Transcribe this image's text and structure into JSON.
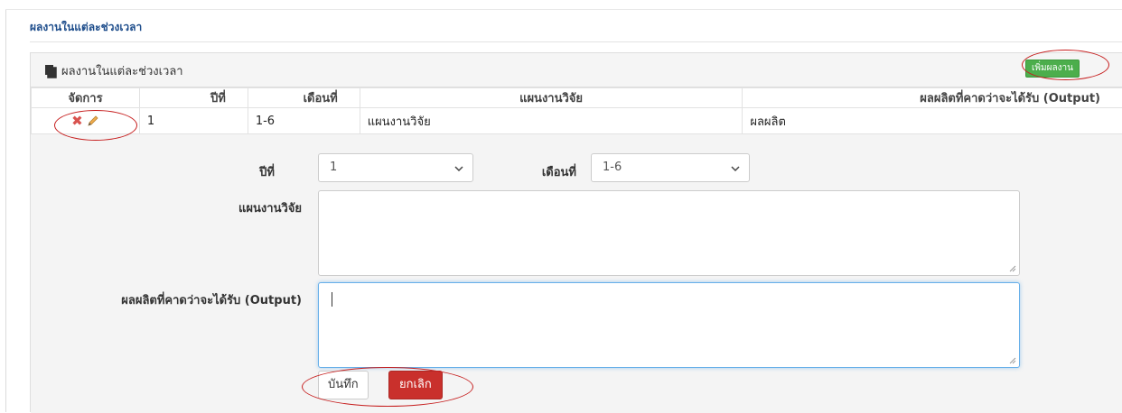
{
  "section_title": "ผลงานในแต่ละช่วงเวลา",
  "panel": {
    "title": "ผลงานในแต่ละช่วงเวลา",
    "add_button": "เพิ่มผลงาน"
  },
  "table": {
    "headers": [
      "จัดการ",
      "ปีที่",
      "เดือนที่",
      "แผนงานวิจัย",
      "ผลผลิตที่คาดว่าจะได้รับ (Output)"
    ],
    "rows": [
      {
        "year": "1",
        "month": "1-6",
        "plan": "แผนงานวิจัย",
        "output": "ผลผลิต"
      }
    ]
  },
  "form": {
    "year_label": "ปีที่",
    "year_value": "1",
    "month_label": "เดือนที่",
    "month_value": "1-6",
    "plan_label": "แผนงานวิจัย",
    "plan_value": "",
    "output_label": "ผลผลิตที่คาดว่าจะได้รับ (Output)",
    "output_value": "",
    "save_button": "บันทึก",
    "cancel_button": "ยกเลิก"
  },
  "colors": {
    "title_blue": "#1f4e8c",
    "add_green": "#4cae4c",
    "cancel_red": "#c9302c",
    "delete_red": "#d9534f",
    "highlight_red": "#c61e1e"
  },
  "icons": [
    "copy-icon",
    "delete-icon",
    "edit-pencil-icon",
    "chevron-down-icon"
  ]
}
